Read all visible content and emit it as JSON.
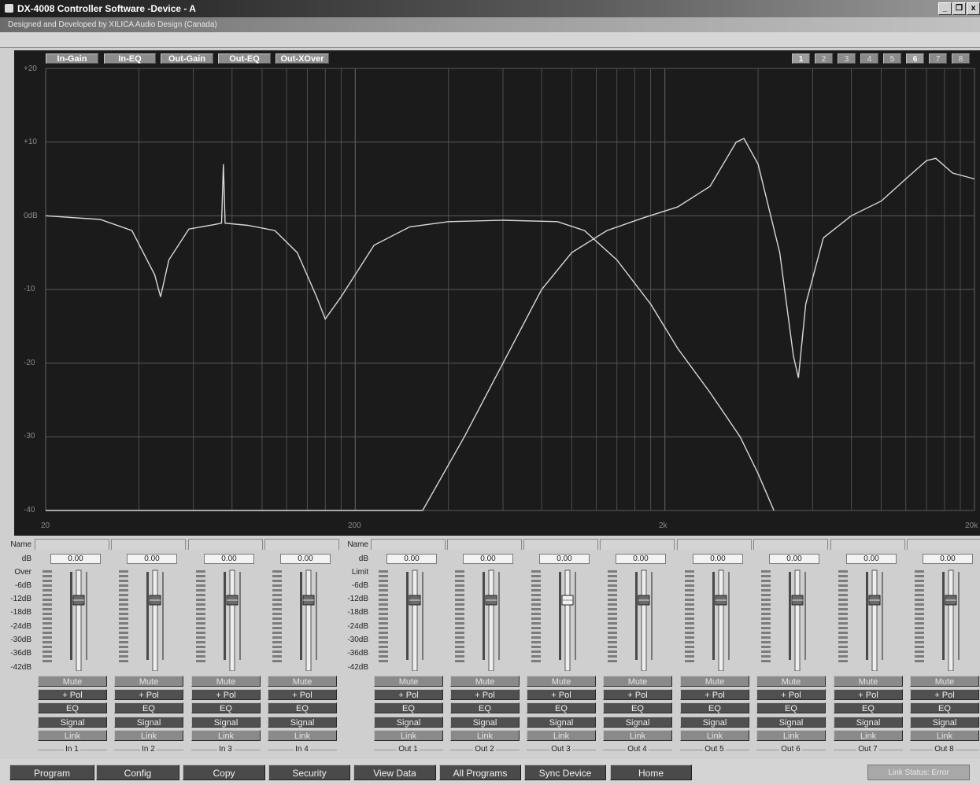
{
  "window": {
    "title": "DX-4008 Controller Software -Device - A",
    "subtitle": "Designed and Developed by XILICA Audio Design (Canada)",
    "controls": [
      "_",
      "8",
      "x"
    ]
  },
  "graph": {
    "mode_buttons": [
      "In-Gain",
      "In-EQ",
      "Out-Gain",
      "Out-EQ",
      "Out-XOver"
    ],
    "preset_buttons": [
      "1",
      "2",
      "3",
      "4",
      "5",
      "6",
      "7",
      "8"
    ],
    "active_presets": [
      "1",
      "6"
    ],
    "y_labels": [
      "+20",
      "+10",
      "0dB",
      "-10",
      "-20",
      "-30",
      "-40"
    ],
    "x_labels": [
      "20",
      "200",
      "2k",
      "20k"
    ]
  },
  "chart_data": {
    "type": "line",
    "xlabel": "",
    "ylabel": "",
    "x_scale": "log",
    "xlim": [
      20,
      20000
    ],
    "ylim": [
      -40,
      20
    ],
    "grid": true,
    "series": [
      {
        "points": [
          [
            20,
            0
          ],
          [
            30,
            -0.5
          ],
          [
            38,
            -2
          ],
          [
            45,
            -8
          ],
          [
            47,
            -11
          ],
          [
            50,
            -6
          ],
          [
            58,
            -1.8
          ],
          [
            70,
            -1.2
          ],
          [
            74,
            -1
          ],
          [
            75,
            7
          ],
          [
            76,
            -1
          ],
          [
            90,
            -1.3
          ],
          [
            110,
            -2
          ],
          [
            130,
            -5
          ],
          [
            150,
            -11
          ],
          [
            160,
            -14
          ],
          [
            180,
            -11
          ],
          [
            230,
            -4
          ],
          [
            300,
            -1.5
          ],
          [
            400,
            -0.8
          ],
          [
            600,
            -0.6
          ],
          [
            900,
            -0.8
          ]
        ]
      },
      {
        "points": [
          [
            330,
            -40
          ],
          [
            450,
            -30
          ],
          [
            600,
            -20
          ],
          [
            800,
            -10
          ],
          [
            1000,
            -5
          ],
          [
            1300,
            -2
          ],
          [
            1700,
            -0.3
          ],
          [
            2200,
            1.2
          ],
          [
            2800,
            4
          ],
          [
            3400,
            10
          ],
          [
            3600,
            10.5
          ],
          [
            4000,
            7
          ],
          [
            4700,
            -5
          ],
          [
            5200,
            -19
          ],
          [
            5400,
            -22
          ],
          [
            5700,
            -12
          ],
          [
            6500,
            -3
          ],
          [
            8000,
            0
          ],
          [
            10000,
            2
          ],
          [
            12000,
            5
          ],
          [
            14000,
            7.5
          ],
          [
            15000,
            7.8
          ],
          [
            17000,
            5.8
          ],
          [
            20000,
            5
          ]
        ]
      },
      {
        "points": [
          [
            20,
            -40
          ],
          [
            330,
            -40
          ]
        ]
      },
      {
        "points": [
          [
            900,
            -0.8
          ],
          [
            1100,
            -2
          ],
          [
            1400,
            -6
          ],
          [
            1800,
            -12
          ],
          [
            2200,
            -18
          ],
          [
            2800,
            -24
          ],
          [
            3500,
            -30
          ],
          [
            4000,
            -35
          ],
          [
            4500,
            -40
          ]
        ]
      }
    ]
  },
  "inputs": {
    "side_labels": [
      "Name",
      "dB",
      "Over",
      "-6dB",
      "-12dB",
      "-18dB",
      "-24dB",
      "-30dB",
      "-36dB",
      "-42dB"
    ],
    "channels": [
      {
        "label": "In 1",
        "db": "0.00"
      },
      {
        "label": "In 2",
        "db": "0.00"
      },
      {
        "label": "In 3",
        "db": "0.00"
      },
      {
        "label": "In 4",
        "db": "0.00"
      }
    ]
  },
  "outputs": {
    "side_labels": [
      "Name",
      "dB",
      "Limit",
      "-6dB",
      "-12dB",
      "-18dB",
      "-24dB",
      "-30dB",
      "-36dB",
      "-42dB"
    ],
    "channels": [
      {
        "label": "Out 1",
        "db": "0.00"
      },
      {
        "label": "Out 2",
        "db": "0.00"
      },
      {
        "label": "Out 3",
        "db": "0.00"
      },
      {
        "label": "Out 4",
        "db": "0.00"
      },
      {
        "label": "Out 5",
        "db": "0.00"
      },
      {
        "label": "Out 6",
        "db": "0.00"
      },
      {
        "label": "Out 7",
        "db": "0.00"
      },
      {
        "label": "Out 8",
        "db": "0.00"
      }
    ]
  },
  "strip_buttons": {
    "mute": "Mute",
    "pol": "+ Pol",
    "eq": "EQ",
    "signal": "Signal",
    "link": "Link"
  },
  "bottom_buttons": [
    "Program",
    "Config",
    "Copy",
    "Security",
    "View Data",
    "All Programs",
    "Sync Device",
    "Home"
  ],
  "link_status": "Link Status: Error",
  "colors": {
    "graph_bg": "#1b1b1b",
    "grid": "#5a5a5a",
    "curve": "#d8d8d8",
    "button_dark": "#4a4a4a"
  }
}
